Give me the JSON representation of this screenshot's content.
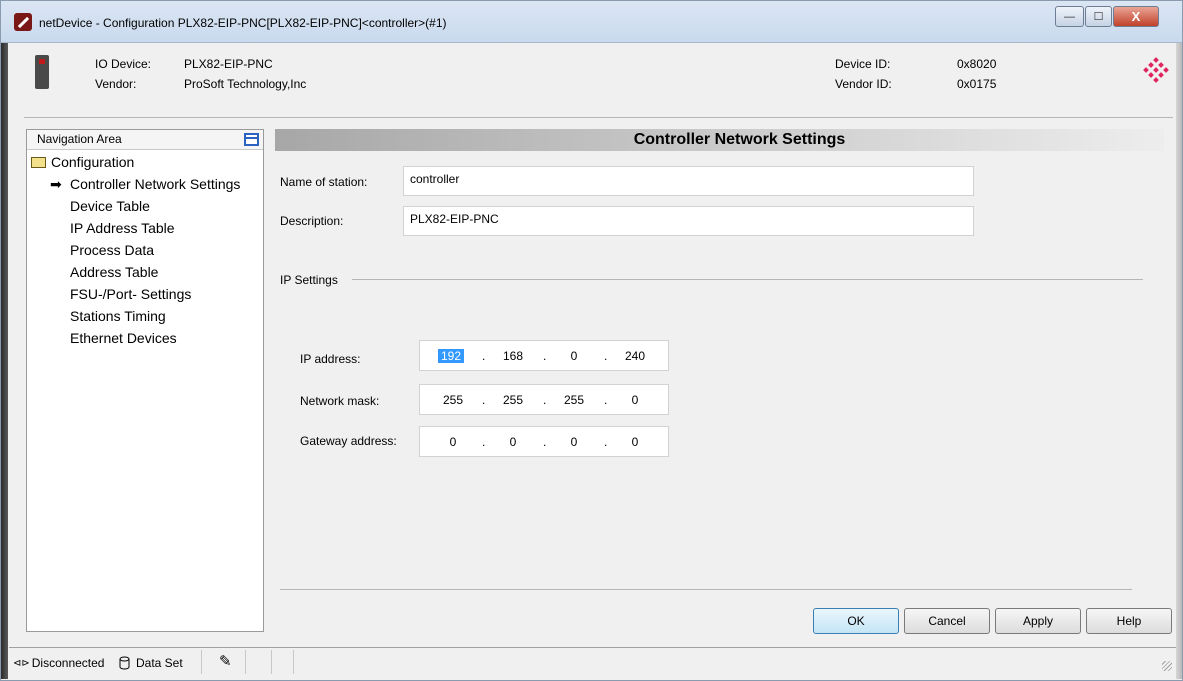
{
  "window": {
    "title": "netDevice - Configuration PLX82-EIP-PNC[PLX82-EIP-PNC]<controller>(#1)",
    "minimize_glyph": "—",
    "maximize_glyph": "☐",
    "close_glyph": "X"
  },
  "device_header": {
    "io_device_label": "IO Device:",
    "io_device_value": "PLX82-EIP-PNC",
    "vendor_label": "Vendor:",
    "vendor_value": "ProSoft Technology,Inc",
    "device_id_label": "Device ID:",
    "device_id_value": "0x8020",
    "vendor_id_label": "Vendor ID:",
    "vendor_id_value": "0x0175",
    "logo_color": "#e0245e"
  },
  "navigation": {
    "title": "Navigation Area",
    "root": "Configuration",
    "selected_marker": "➡",
    "items": [
      {
        "label": "Controller Network Settings",
        "selected": true
      },
      {
        "label": "Device Table"
      },
      {
        "label": "IP Address Table"
      },
      {
        "label": "Process Data"
      },
      {
        "label": "Address Table"
      },
      {
        "label": "FSU-/Port- Settings"
      },
      {
        "label": "Stations Timing"
      },
      {
        "label": "Ethernet Devices"
      }
    ]
  },
  "panel": {
    "title": "Controller Network Settings",
    "name_of_station_label": "Name of station:",
    "name_of_station_value": "controller",
    "description_label": "Description:",
    "description_value": "PLX82-EIP-PNC",
    "ip_settings_label": "IP Settings",
    "ip_address_label": "IP address:",
    "ip_address": [
      "192",
      "168",
      "0",
      "240"
    ],
    "network_mask_label": "Network mask:",
    "network_mask": [
      "255",
      "255",
      "255",
      "0"
    ],
    "gateway_label": "Gateway address:",
    "gateway": [
      "0",
      "0",
      "0",
      "0"
    ],
    "octet_separator": "."
  },
  "buttons": {
    "ok": "OK",
    "cancel": "Cancel",
    "apply": "Apply",
    "help": "Help"
  },
  "status_bar": {
    "connection": "Disconnected",
    "connection_icon": "⊲⊳",
    "data_set": "Data Set",
    "pen_glyph": "✎"
  }
}
